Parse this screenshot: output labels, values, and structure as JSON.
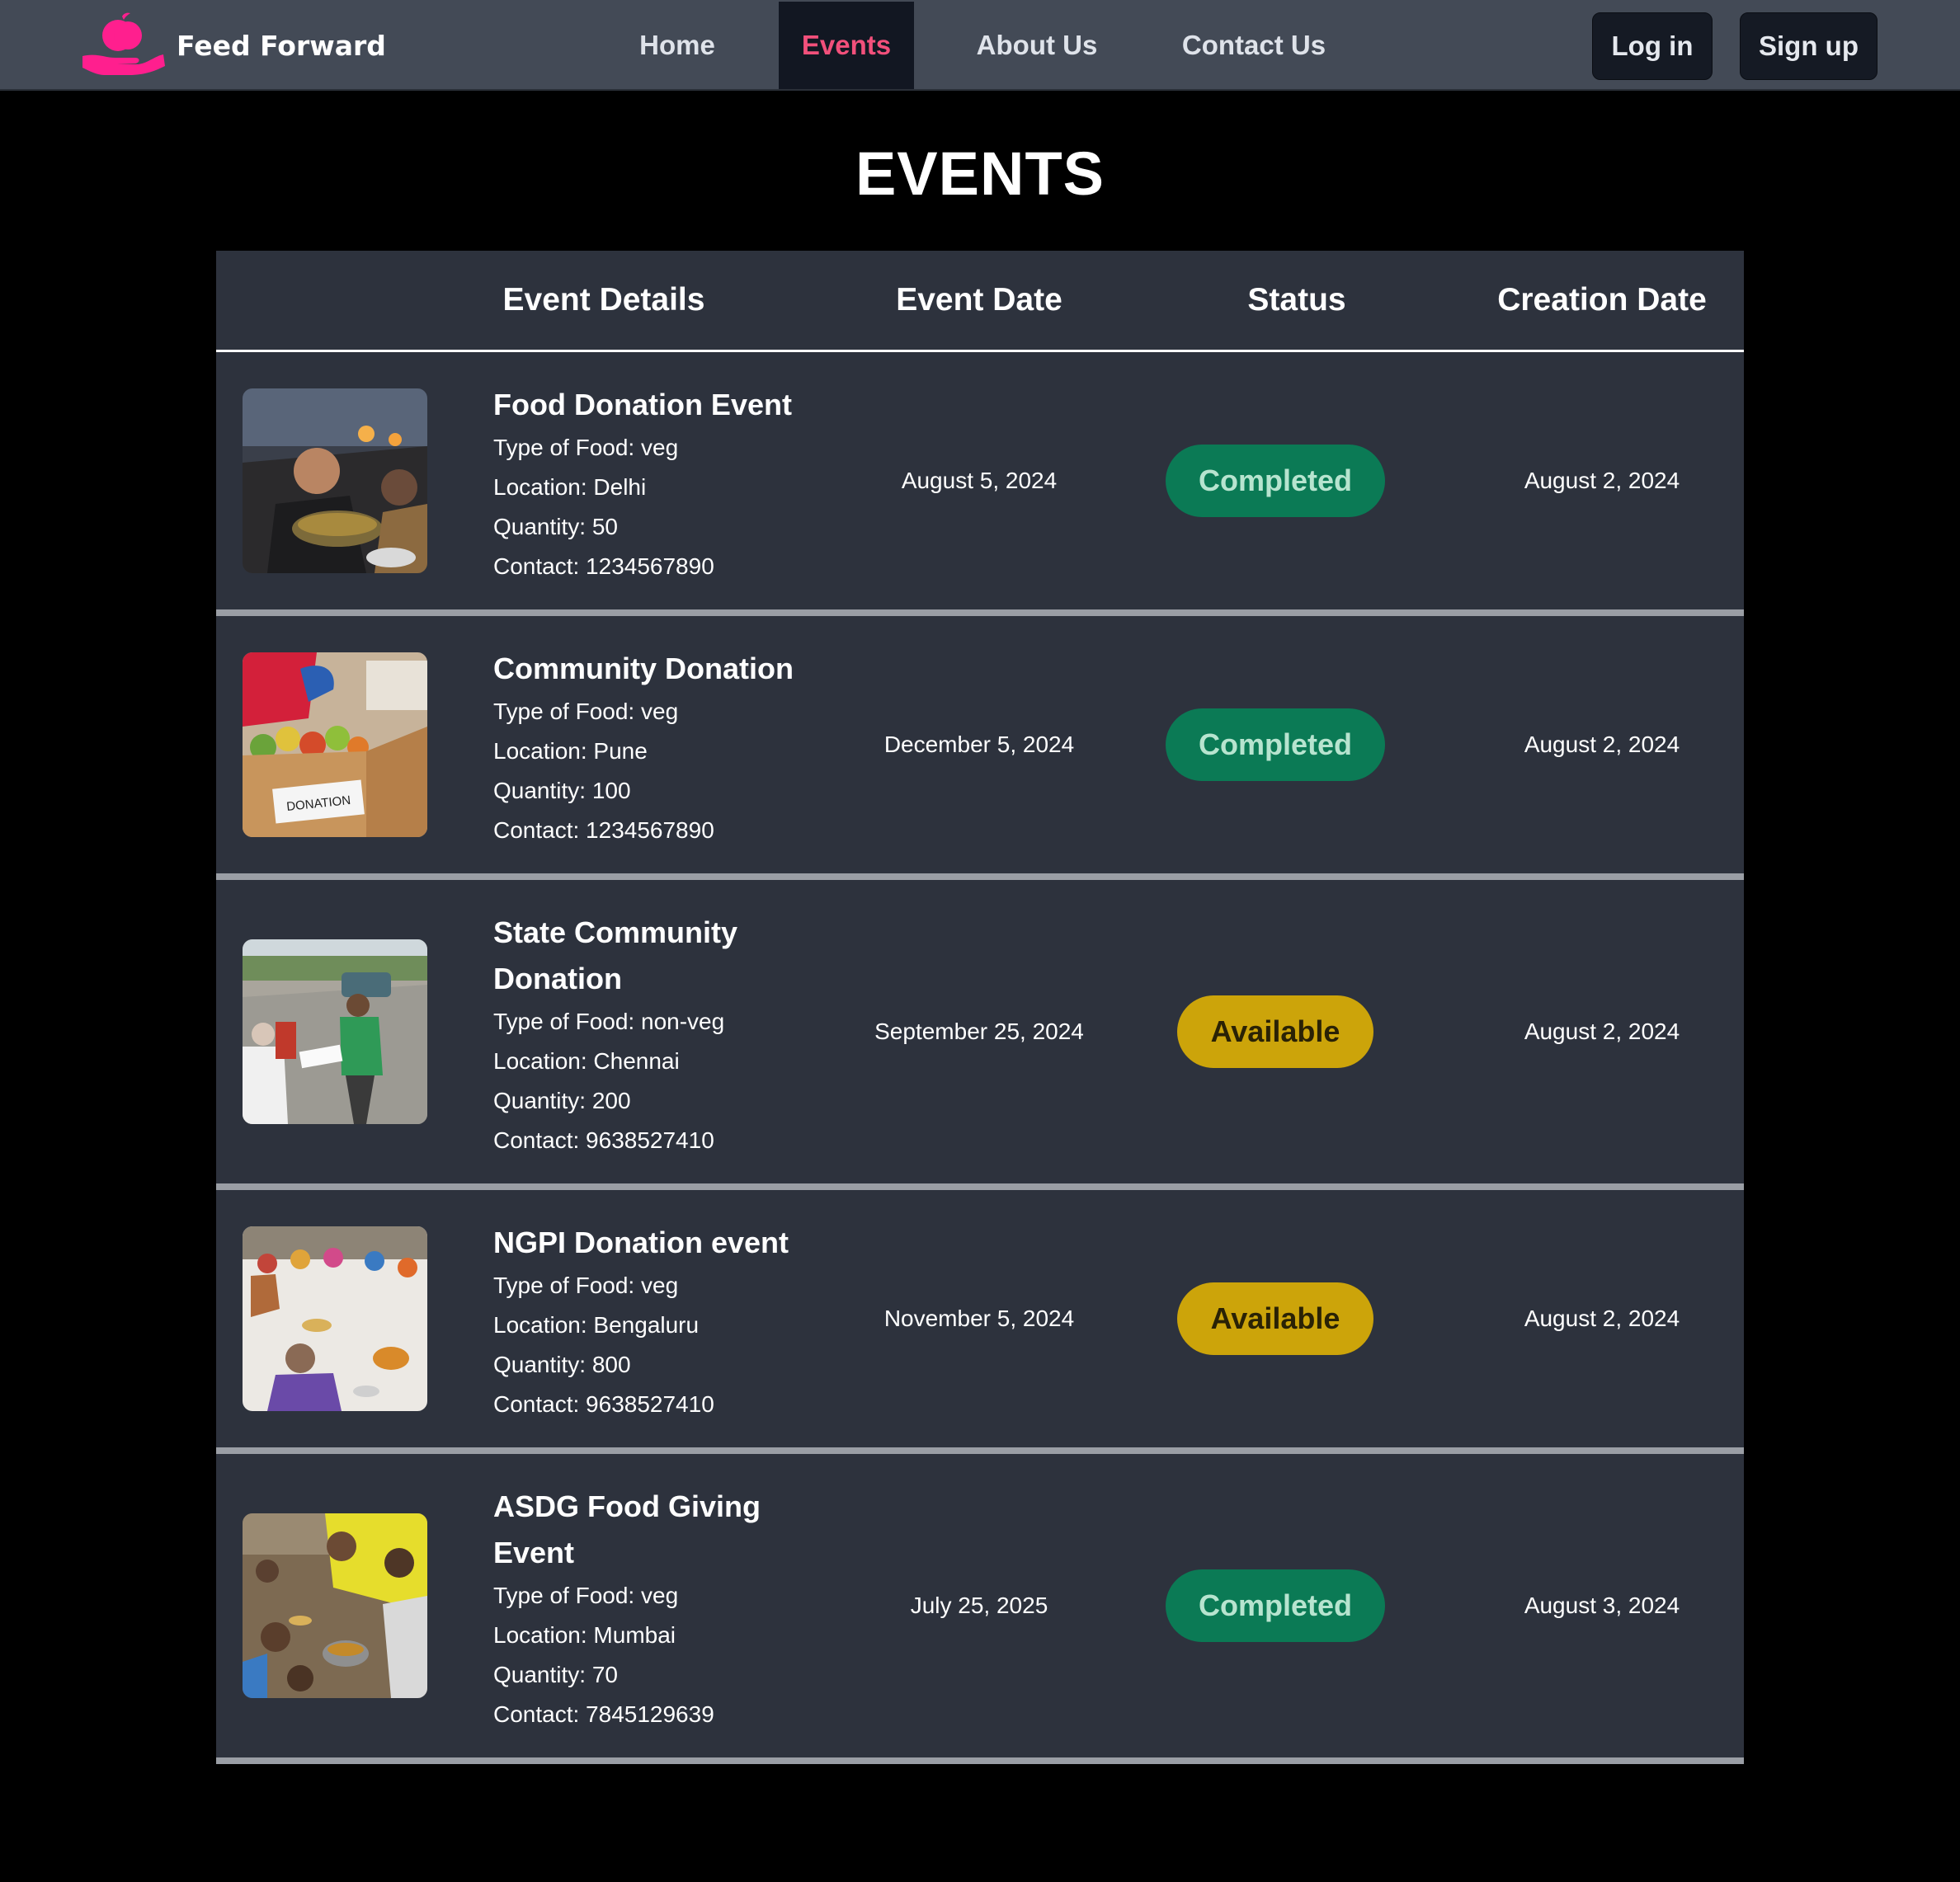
{
  "navbar": {
    "brand": "Feed Forward",
    "links": [
      "Home",
      "Events",
      "About Us",
      "Contact Us"
    ],
    "active": "Events",
    "login": "Log in",
    "signup": "Sign up",
    "accent_color": "#f2507b",
    "logo_icon": "apple-on-hand-icon"
  },
  "page": {
    "title": "EVENTS"
  },
  "table": {
    "headers": [
      "Event Details",
      "Event Date",
      "Status",
      "Creation Date"
    ],
    "rows": [
      {
        "title": "Food Donation Event",
        "type_of_food": "Type of Food: veg",
        "location": "Location: Delhi",
        "quantity": "Quantity: 50",
        "contact": "Contact: 1234567890",
        "event_date": "August 5, 2024",
        "status": "Completed",
        "creation_date": "August 2, 2024"
      },
      {
        "title": "Community Donation",
        "type_of_food": "Type of Food: veg",
        "location": "Location: Pune",
        "quantity": "Quantity: 100",
        "contact": "Contact: 1234567890",
        "event_date": "December 5, 2024",
        "status": "Completed",
        "creation_date": "August 2, 2024",
        "image_text": "DONATION"
      },
      {
        "title": "State Community Donation",
        "type_of_food": "Type of Food: non-veg",
        "location": "Location: Chennai",
        "quantity": "Quantity: 200",
        "contact": "Contact: 9638527410",
        "event_date": "September 25, 2024",
        "status": "Available",
        "creation_date": "August 2, 2024"
      },
      {
        "title": "NGPI Donation event",
        "type_of_food": "Type of Food: veg",
        "location": "Location: Bengaluru",
        "quantity": "Quantity: 800",
        "contact": "Contact: 9638527410",
        "event_date": "November 5, 2024",
        "status": "Available",
        "creation_date": "August 2, 2024"
      },
      {
        "title": "ASDG Food Giving Event",
        "type_of_food": "Type of Food: veg",
        "location": "Location: Mumbai",
        "quantity": "Quantity: 70",
        "contact": "Contact: 7845129639",
        "event_date": "July 25, 2025",
        "status": "Completed",
        "creation_date": "August 3, 2024"
      }
    ]
  },
  "colors": {
    "status_completed": "#0b7a55",
    "status_available": "#cca40a",
    "table_bg": "#2d323d",
    "navbar_bg": "#434a56"
  }
}
